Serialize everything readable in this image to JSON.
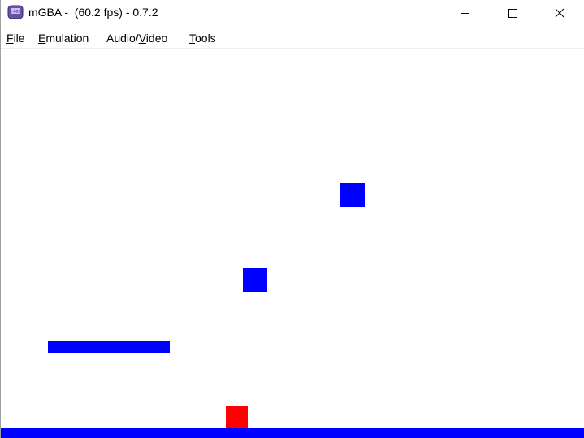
{
  "window": {
    "title": "mGBA -  (60.2 fps) - 0.7.2",
    "app_icon": "mgba-handheld-icon",
    "buttons": {
      "minimize_icon": "minimize-icon",
      "maximize_icon": "maximize-icon",
      "close_icon": "close-icon"
    }
  },
  "menubar": {
    "items": [
      {
        "label": "File",
        "mnemonic": "F"
      },
      {
        "label": "Emulation",
        "mnemonic": "E"
      },
      {
        "label": "Audio/Video",
        "mnemonic": "V"
      },
      {
        "label": "Tools",
        "mnemonic": "T"
      }
    ]
  },
  "game": {
    "background_color": "#ffffff",
    "platform_color": "#0000ff",
    "player_color": "#ff0000"
  }
}
